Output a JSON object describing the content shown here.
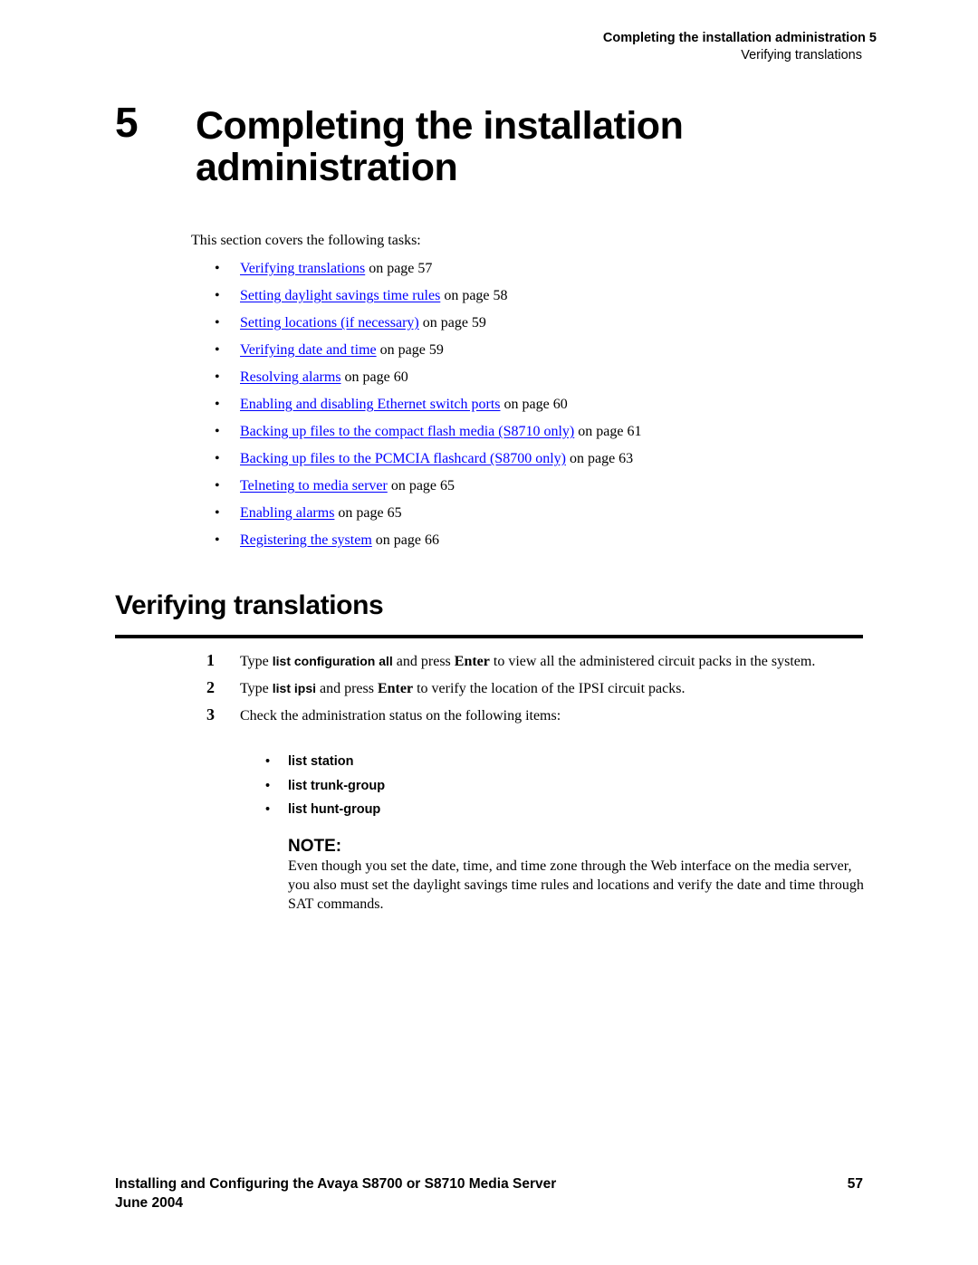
{
  "running_header": {
    "title": "Completing the installation administration 5",
    "subtitle": "Verifying translations"
  },
  "chapter": {
    "number": "5",
    "title": "Completing the installation administration"
  },
  "intro": "This section covers the following tasks:",
  "tasks": [
    {
      "link": "Verifying translations",
      "suffix": " on page 57"
    },
    {
      "link": "Setting daylight savings time rules",
      "suffix": " on page 58"
    },
    {
      "link": "Setting locations (if necessary)",
      "suffix": " on page 59"
    },
    {
      "link": "Verifying date and time",
      "suffix": " on page 59"
    },
    {
      "link": "Resolving alarms",
      "suffix": " on page 60"
    },
    {
      "link": "Enabling and disabling Ethernet switch ports",
      "suffix": " on page 60"
    },
    {
      "link": "Backing up files to the compact flash media (S8710 only)",
      "suffix": " on page 61"
    },
    {
      "link": "Backing up files to the PCMCIA flashcard (S8700 only)",
      "suffix": " on page 63"
    },
    {
      "link": "Telneting to media server",
      "suffix": " on page 65"
    },
    {
      "link": "Enabling alarms",
      "suffix": " on page 65"
    },
    {
      "link": "Registering the system",
      "suffix": " on page 66"
    }
  ],
  "section": {
    "title": "Verifying translations",
    "steps": [
      {
        "num": "1",
        "pre": "Type ",
        "cmd": "list configuration all",
        "mid": " and press ",
        "key": "Enter",
        "post": " to view all the administered circuit packs in the system."
      },
      {
        "num": "2",
        "pre": "Type ",
        "cmd": "list ipsi",
        "mid": " and press ",
        "key": "Enter",
        "post": " to verify the location of the IPSI circuit packs."
      },
      {
        "num": "3",
        "text": "Check the administration status on the following items:"
      }
    ],
    "items": [
      "list station",
      "list trunk-group",
      "list hunt-group"
    ],
    "bullet": "•",
    "note_label": "NOTE:",
    "note_text": "Even though you set the date, time, and time zone through the Web interface on the media server, you also must set the daylight savings time rules and locations and verify the date and time through SAT commands."
  },
  "footer": {
    "title": "Installing and Configuring the Avaya S8700 or S8710 Media Server",
    "date": "June 2004",
    "page_number": "57"
  },
  "colors": {
    "link": "#0000ff",
    "text": "#000000"
  }
}
